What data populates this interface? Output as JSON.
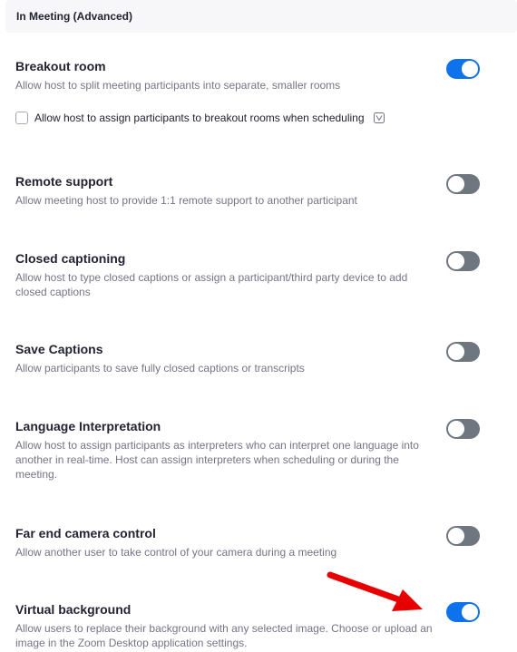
{
  "section": {
    "title": "In Meeting (Advanced)"
  },
  "settings": [
    {
      "title": "Breakout room",
      "description": "Allow host to split meeting participants into separate, smaller rooms",
      "enabled": true
    },
    {
      "title": "Remote support",
      "description": "Allow meeting host to provide 1:1 remote support to another participant",
      "enabled": false
    },
    {
      "title": "Closed captioning",
      "description": "Allow host to type closed captions or assign a participant/third party device to add closed captions",
      "enabled": false
    },
    {
      "title": "Save Captions",
      "description": "Allow participants to save fully closed captions or transcripts",
      "enabled": false
    },
    {
      "title": "Language Interpretation",
      "description": "Allow host to assign participants as interpreters who can interpret one language into another in real-time. Host can assign interpreters when scheduling or during the meeting.",
      "enabled": false
    },
    {
      "title": "Far end camera control",
      "description": "Allow another user to take control of your camera during a meeting",
      "enabled": false
    },
    {
      "title": "Virtual background",
      "description": "Allow users to replace their background with any selected image. Choose or upload an image in the Zoom Desktop application settings.",
      "enabled": true
    }
  ],
  "breakout_sub_option": {
    "label": "Allow host to assign participants to breakout rooms when scheduling",
    "checked": false,
    "icon": "info-icon"
  },
  "annotation": {
    "icon": "red-arrow-icon",
    "color": "#e60000"
  },
  "colors": {
    "toggle_on": "#0e72ed",
    "toggle_off": "#6e7680"
  }
}
